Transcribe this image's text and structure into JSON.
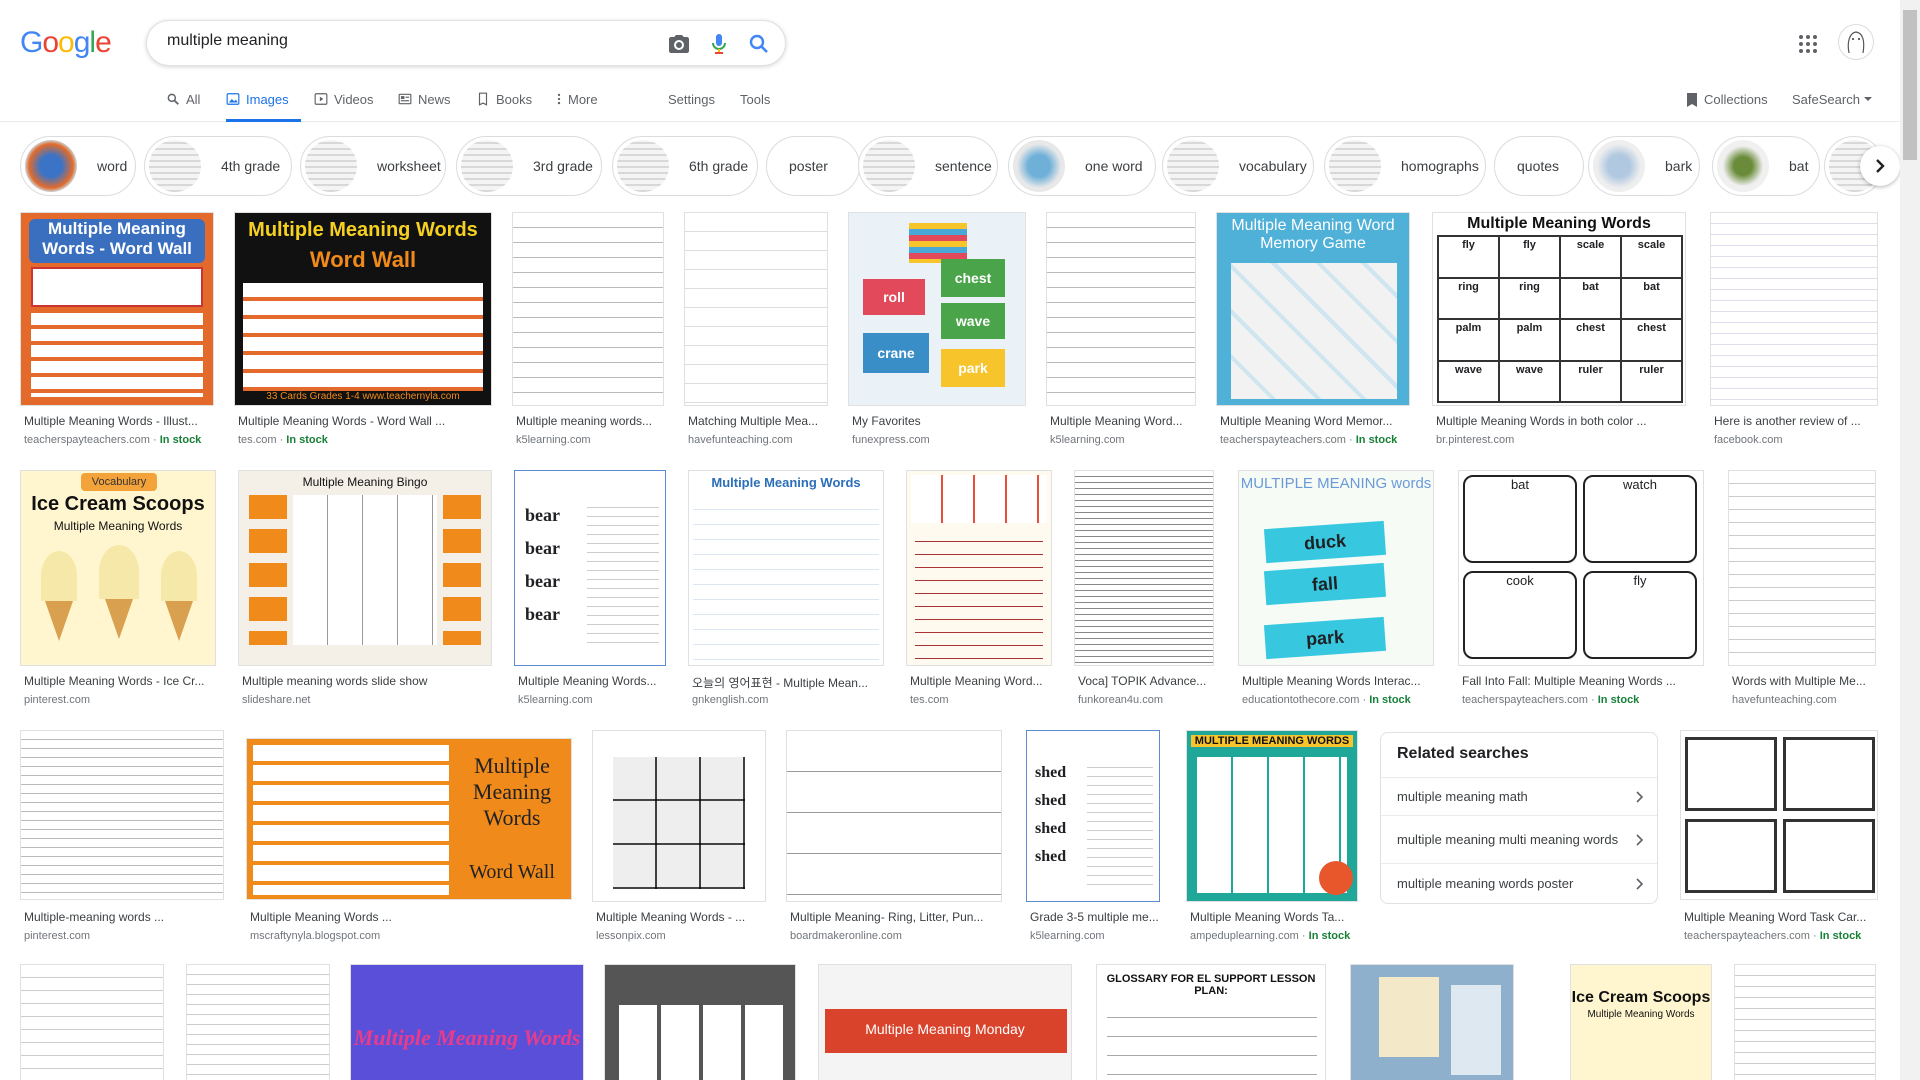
{
  "logo": {
    "letters": [
      "G",
      "o",
      "o",
      "g",
      "l",
      "e"
    ],
    "colors": [
      "#4285F4",
      "#EA4335",
      "#FBBC05",
      "#4285F4",
      "#34A853",
      "#EA4335"
    ]
  },
  "search": {
    "query": "multiple meaning"
  },
  "tabs": [
    {
      "label": "All",
      "icon": "search-icon"
    },
    {
      "label": "Images",
      "icon": "image-icon",
      "active": true
    },
    {
      "label": "Videos",
      "icon": "play-icon"
    },
    {
      "label": "News",
      "icon": "news-icon"
    },
    {
      "label": "Books",
      "icon": "book-icon"
    },
    {
      "label": "More",
      "icon": "more-vert-icon"
    }
  ],
  "tools": {
    "settings": "Settings",
    "tools": "Tools",
    "collections": "Collections",
    "safesearch": "SafeSearch"
  },
  "chips": [
    "word",
    "4th grade",
    "worksheet",
    "3rd grade",
    "6th grade",
    "poster",
    "sentence",
    "one word",
    "vocabulary",
    "homographs",
    "quotes",
    "bark",
    "bat"
  ],
  "results": [
    {
      "title": "Multiple Meaning Words - Illust...",
      "source": "teacherspayteachers.com",
      "stock": "In stock"
    },
    {
      "title": "Multiple Meaning Words - Word Wall ...",
      "source": "tes.com",
      "stock": "In stock"
    },
    {
      "title": "Multiple meaning words...",
      "source": "k5learning.com",
      "stock": ""
    },
    {
      "title": "Matching Multiple Mea...",
      "source": "havefunteaching.com",
      "stock": ""
    },
    {
      "title": "My Favorites",
      "source": "funexpress.com",
      "stock": ""
    },
    {
      "title": "Multiple Meaning Word...",
      "source": "k5learning.com",
      "stock": ""
    },
    {
      "title": "Multiple Meaning Word Memor...",
      "source": "teacherspayteachers.com",
      "stock": "In stock"
    },
    {
      "title": "Multiple Meaning Words in both color ...",
      "source": "br.pinterest.com",
      "stock": ""
    },
    {
      "title": "Here is another review of ...",
      "source": "facebook.com",
      "stock": ""
    },
    {
      "title": "Multiple Meaning Words - Ice Cr...",
      "source": "pinterest.com",
      "stock": ""
    },
    {
      "title": "Multiple meaning words slide show",
      "source": "slideshare.net",
      "stock": ""
    },
    {
      "title": "Multiple Meaning Words...",
      "source": "k5learning.com",
      "stock": ""
    },
    {
      "title": "오늘의 영어표현 - Multiple Mean...",
      "source": "gnkenglish.com",
      "stock": ""
    },
    {
      "title": "Multiple Meaning Word...",
      "source": "tes.com",
      "stock": ""
    },
    {
      "title": "Voca] TOPIK Advance...",
      "source": "funkorean4u.com",
      "stock": ""
    },
    {
      "title": "Multiple Meaning Words Interac...",
      "source": "educationtothecore.com",
      "stock": "In stock"
    },
    {
      "title": "Fall Into Fall: Multiple Meaning Words ...",
      "source": "teacherspayteachers.com",
      "stock": "In stock"
    },
    {
      "title": "Words with Multiple Me...",
      "source": "havefunteaching.com",
      "stock": ""
    },
    {
      "title": "Multiple-meaning words ...",
      "source": "pinterest.com",
      "stock": ""
    },
    {
      "title": "Multiple Meaning Words ...",
      "source": "mscraftynyla.blogspot.com",
      "stock": ""
    },
    {
      "title": "Multiple Meaning Words - ...",
      "source": "lessonpix.com",
      "stock": ""
    },
    {
      "title": "Multiple Meaning- Ring, Litter, Pun...",
      "source": "boardmakeronline.com",
      "stock": ""
    },
    {
      "title": "Grade 3-5 multiple me...",
      "source": "k5learning.com",
      "stock": ""
    },
    {
      "title": "Multiple Meaning Words Ta...",
      "source": "ampeduplearning.com",
      "stock": "In stock"
    },
    {
      "title": "Multiple Meaning Word Task Car...",
      "source": "teacherspayteachers.com",
      "stock": "In stock"
    }
  ],
  "image_text": {
    "r1a": "Multiple Meaning Words - Word Wall",
    "r1b_title": "Multiple Meaning Words",
    "r1b_sub": "Word Wall",
    "r1b_foot": "33 Cards  Grades 1-4  www.teachernyla.com",
    "r1e_words": [
      "chest",
      "roll",
      "wave",
      "crane",
      "park"
    ],
    "r1g": "Multiple Meaning Word Memory Game",
    "r1h": "Multiple Meaning Words",
    "r1h_words": [
      "fly",
      "fly",
      "scale",
      "scale",
      "ring",
      "ring",
      "bat",
      "bat",
      "palm",
      "palm",
      "chest",
      "chest",
      "wave",
      "wave",
      "ruler",
      "ruler"
    ],
    "r2a_tag": "Vocabulary",
    "r2a_title": "Ice Cream Scoops",
    "r2a_sub": "Multiple Meaning Words",
    "r2b": "Multiple Meaning Bingo",
    "r2c_words": [
      "bear",
      "bear",
      "bear",
      "bear"
    ],
    "r2d": "Multiple Meaning Words",
    "r2g": "MULTIPLE MEANING words",
    "r2g_words": [
      "duck",
      "fall",
      "park"
    ],
    "r2h_words": [
      "bat",
      "watch",
      "cook",
      "fly"
    ],
    "r3b_title": "Multiple Meaning Words",
    "r3b_sub": "Word Wall",
    "r3e_words": [
      "shed",
      "shed",
      "shed",
      "shed"
    ],
    "r3f": "MULTIPLE MEANING WORDS",
    "r4c": "Multiple Meaning Words",
    "r4e": "Multiple Meaning Monday",
    "r4f": "GLOSSARY FOR EL SUPPORT LESSON PLAN:",
    "r4h_title": "Ice Cream Scoops",
    "r4h_sub": "Multiple Meaning Words"
  },
  "related": {
    "title": "Related searches",
    "items": [
      "multiple meaning math",
      "multiple meaning multi meaning words",
      "multiple meaning words poster"
    ]
  }
}
